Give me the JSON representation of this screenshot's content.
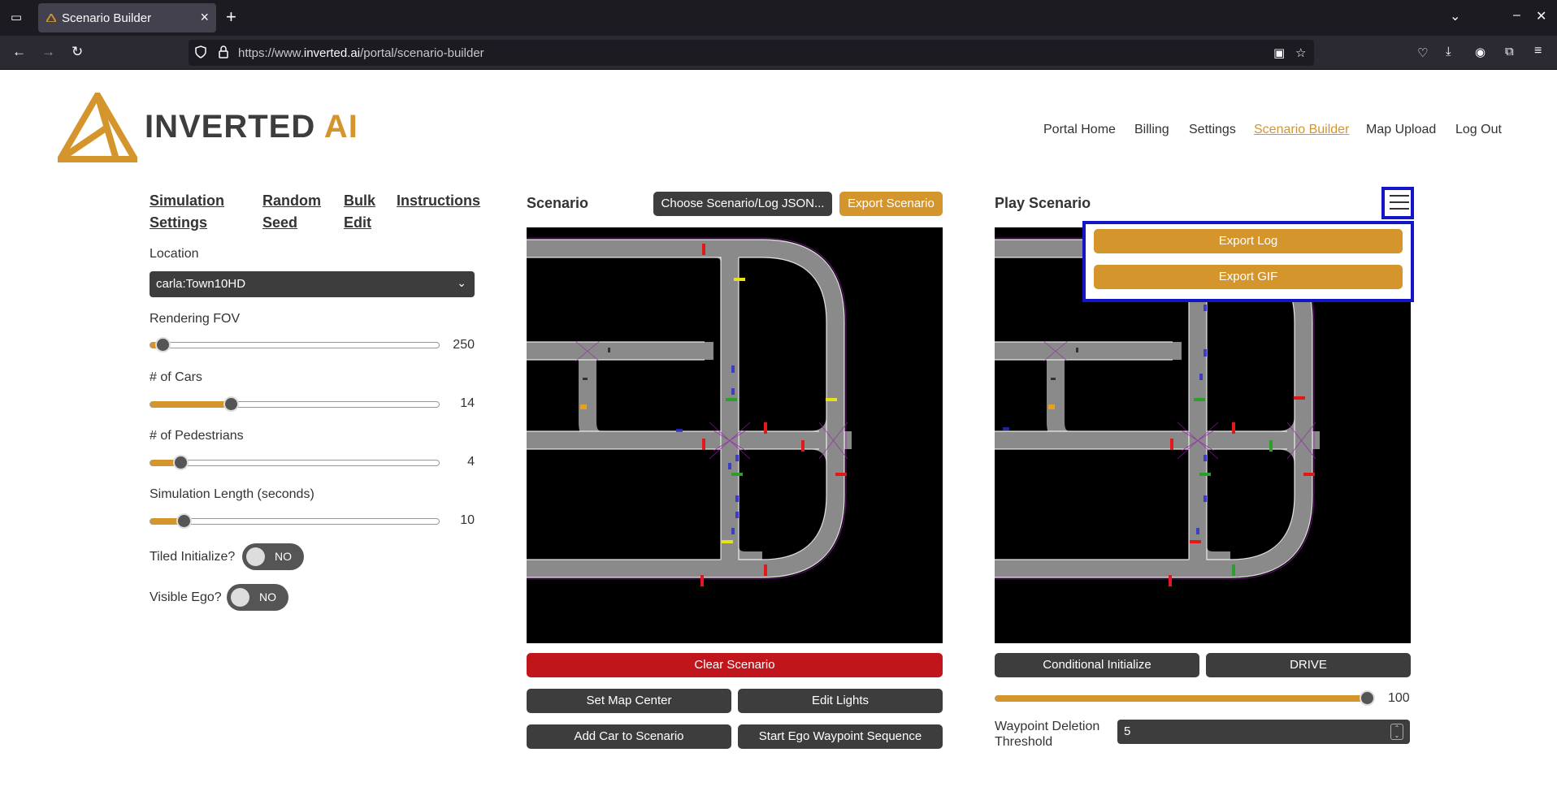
{
  "browser": {
    "tab_title": "Scenario Builder",
    "url_prefix": "https://www.",
    "url_domain": "inverted.ai",
    "url_path": "/portal/scenario-builder"
  },
  "header": {
    "brand_main": "INVERTED",
    "brand_accent": "AI",
    "nav": [
      "Portal Home",
      "Billing",
      "Settings",
      "Scenario Builder",
      "Map Upload",
      "Log Out"
    ],
    "active_nav": "Scenario Builder",
    "accent_color": "#d4952d"
  },
  "left_panel": {
    "tabs": {
      "sim_settings_1": "Simulation",
      "sim_settings_2": "Settings",
      "random_seed_1": "Random",
      "random_seed_2": "Seed",
      "bulk_edit_1": "Bulk",
      "bulk_edit_2": "Edit",
      "instructions": "Instructions"
    },
    "location_label": "Location",
    "location_value": "carla:Town10HD",
    "fov_label": "Rendering FOV",
    "fov_value": "250",
    "cars_label": "# of Cars",
    "cars_value": "14",
    "peds_label": "# of Pedestrians",
    "peds_value": "4",
    "length_label": "Simulation Length (seconds)",
    "length_value": "10",
    "tiled_label": "Tiled Initialize?",
    "tiled_state": "NO",
    "ego_label": "Visible Ego?",
    "ego_state": "NO"
  },
  "scenario_panel": {
    "title": "Scenario",
    "choose_btn": "Choose Scenario/Log JSON...",
    "export_btn": "Export Scenario",
    "clear_btn": "Clear Scenario",
    "set_center_btn": "Set Map Center",
    "edit_lights_btn": "Edit Lights",
    "add_car_btn": "Add Car to Scenario",
    "waypoint_btn": "Start Ego Waypoint Sequence"
  },
  "play_panel": {
    "title": "Play Scenario",
    "export_log_btn": "Export Log",
    "export_gif_btn": "Export GIF",
    "cond_init_btn": "Conditional Initialize",
    "drive_btn": "DRIVE",
    "progress_value": "100",
    "waypoint_label_1": "Waypoint Deletion",
    "waypoint_label_2": "Threshold",
    "waypoint_value": "5"
  }
}
